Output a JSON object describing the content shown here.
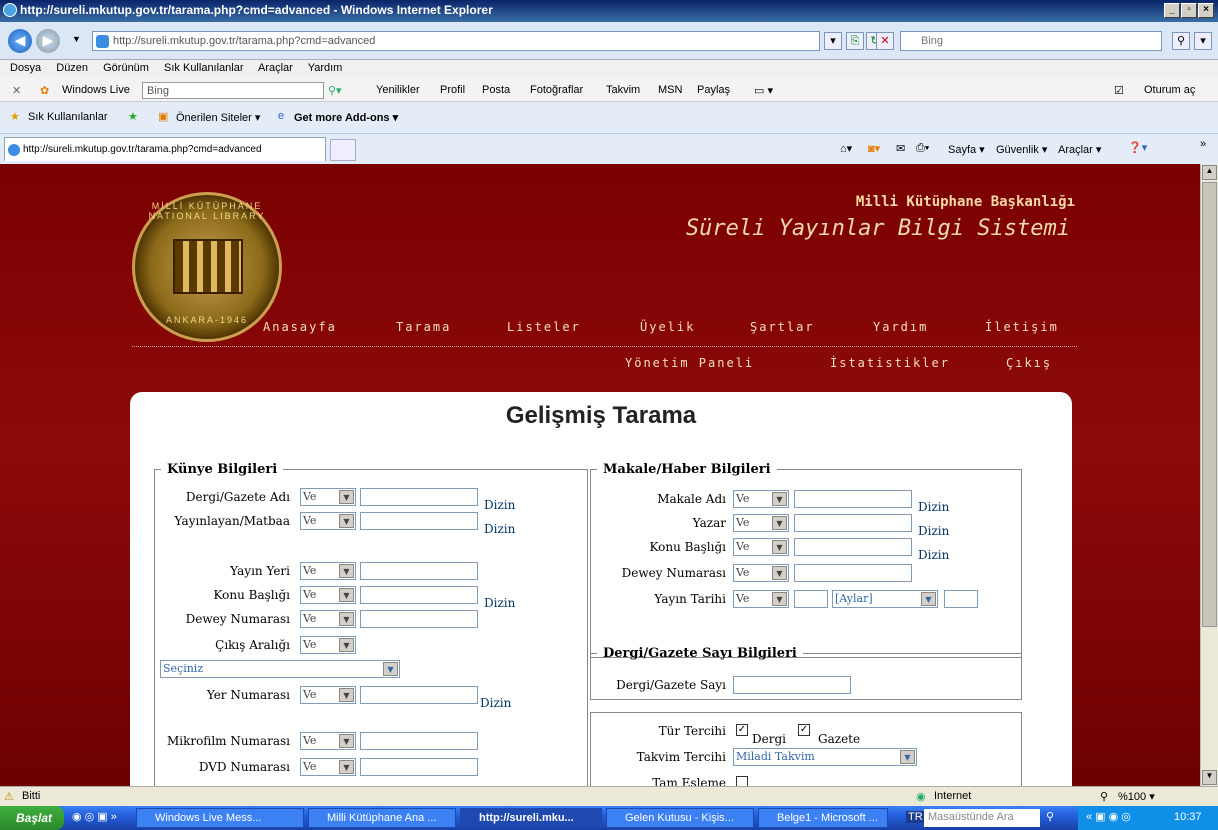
{
  "window": {
    "title": "http://sureli.mkutup.gov.tr/tarama.php?cmd=advanced - Windows Internet Explorer"
  },
  "address": {
    "url": "http://sureli.mkutup.gov.tr/tarama.php?cmd=advanced",
    "search": "Bing"
  },
  "menu": [
    "Dosya",
    "Düzen",
    "Görünüm",
    "Sık Kullanılanlar",
    "Araçlar",
    "Yardım"
  ],
  "live": {
    "brand": "Windows Live",
    "search": "Bing",
    "links": [
      "Yenilikler",
      "Profil",
      "Posta",
      "Fotoğraflar",
      "Takvim",
      "MSN",
      "Paylaş"
    ],
    "signin": "Oturum aç"
  },
  "fav": {
    "favorites": "Sık Kullanılanlar",
    "suggested": "Önerilen Siteler ▾",
    "addons": "Get more Add-ons ▾"
  },
  "tab": {
    "label": "http://sureli.mkutup.gov.tr/tarama.php?cmd=advanced"
  },
  "cmdbar": {
    "sayfa": "Sayfa ▾",
    "guvenlik": "Güvenlik ▾",
    "araclar": "Araçlar ▾"
  },
  "site": {
    "org": "Milli Kütüphane Başkanlığı",
    "system": "Süreli Yayınlar Bilgi Sistemi",
    "logo_top": "MİLLİ KÜTÜPHANE NATIONAL LIBRARY",
    "logo_bottom": "ANKARA-1946",
    "nav": [
      "Anasayfa",
      "Tarama",
      "Listeler",
      "Üyelik",
      "Şartlar",
      "Yardım",
      "İletişim"
    ],
    "nav2": [
      "Yönetim Paneli",
      "İstatistikler",
      "Çıkış"
    ]
  },
  "form": {
    "title": "Gelişmiş Tarama",
    "kunye": {
      "legend": "Künye Bilgileri",
      "dergi": "Dergi/Gazete Adı",
      "yayinlayan": "Yayınlayan/Matbaa",
      "yayinyeri": "Yayın Yeri",
      "konu": "Konu Başlığı",
      "dewey": "Dewey Numarası",
      "cikis": "Çıkış Aralığı",
      "seciniz": "Seçiniz",
      "yer": "Yer Numarası",
      "mikrofilm": "Mikrofilm Numarası",
      "dvd": "DVD Numarası"
    },
    "makale": {
      "legend": "Makale/Haber Bilgileri",
      "adi": "Makale Adı",
      "yazar": "Yazar",
      "konu": "Konu Başlığı",
      "dewey": "Dewey Numarası",
      "tarih": "Yayın Tarihi",
      "aylar": "[Aylar]"
    },
    "sayi": {
      "legend": "Dergi/Gazete Sayı Bilgileri",
      "label": "Dergi/Gazete Sayı"
    },
    "tercih": {
      "tur": "Tür Tercihi",
      "dergi": "Dergi",
      "gazete": "Gazete",
      "takvim": "Takvim Tercihi",
      "takvim_value": "Miladi Takvim",
      "tam": "Tam Eşleme"
    },
    "op": "Ve",
    "dizin": "Dizin"
  },
  "status": {
    "text": "Bitti",
    "zone": "Internet",
    "zoom": "%100 ▾"
  },
  "taskbar": {
    "start": "Başlat",
    "tasks": [
      "Windows Live Mess...",
      "Milli Kütüphane Ana ...",
      "http://sureli.mku...",
      "Gelen Kutusu - Kişis...",
      "Belge1 - Microsoft ...",
      "Masaüstünde Ara"
    ],
    "lang": "TR",
    "clock": "10:37"
  }
}
